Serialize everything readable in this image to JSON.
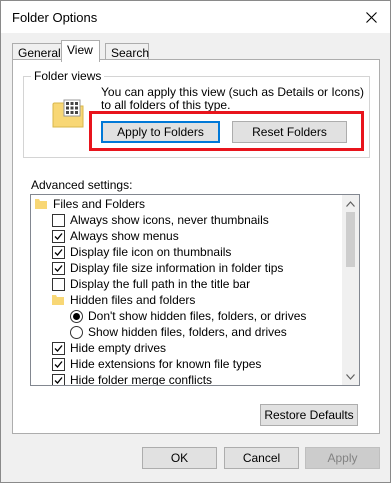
{
  "window": {
    "title": "Folder Options"
  },
  "tabs": [
    {
      "label": "General"
    },
    {
      "label": "View"
    },
    {
      "label": "Search"
    }
  ],
  "folder_views": {
    "label": "Folder views",
    "description": "You can apply this view (such as Details or Icons) to all folders of this type.",
    "apply_button": "Apply to Folders",
    "reset_button": "Reset Folders"
  },
  "advanced": {
    "label": "Advanced settings:",
    "items": [
      {
        "label": "Files and Folders"
      },
      {
        "label": "Always show icons, never thumbnails",
        "checked": false
      },
      {
        "label": "Always show menus",
        "checked": true
      },
      {
        "label": "Display file icon on thumbnails",
        "checked": true
      },
      {
        "label": "Display file size information in folder tips",
        "checked": true
      },
      {
        "label": "Display the full path in the title bar",
        "checked": false
      },
      {
        "label": "Hidden files and folders"
      },
      {
        "label": "Don't show hidden files, folders, or drives",
        "selected": true
      },
      {
        "label": "Show hidden files, folders, and drives",
        "selected": false
      },
      {
        "label": "Hide empty drives",
        "checked": true
      },
      {
        "label": "Hide extensions for known file types",
        "checked": true
      },
      {
        "label": "Hide folder merge conflicts",
        "checked": true
      }
    ]
  },
  "restore_button": "Restore Defaults",
  "footer": {
    "ok": "OK",
    "cancel": "Cancel",
    "apply": "Apply"
  },
  "colors": {
    "highlight": "#e8141c",
    "accent": "#0078d7",
    "folder": "#f8d775"
  },
  "icons": {
    "close": "close-icon",
    "folder": "folder-icon",
    "check": "checkmark-icon"
  }
}
